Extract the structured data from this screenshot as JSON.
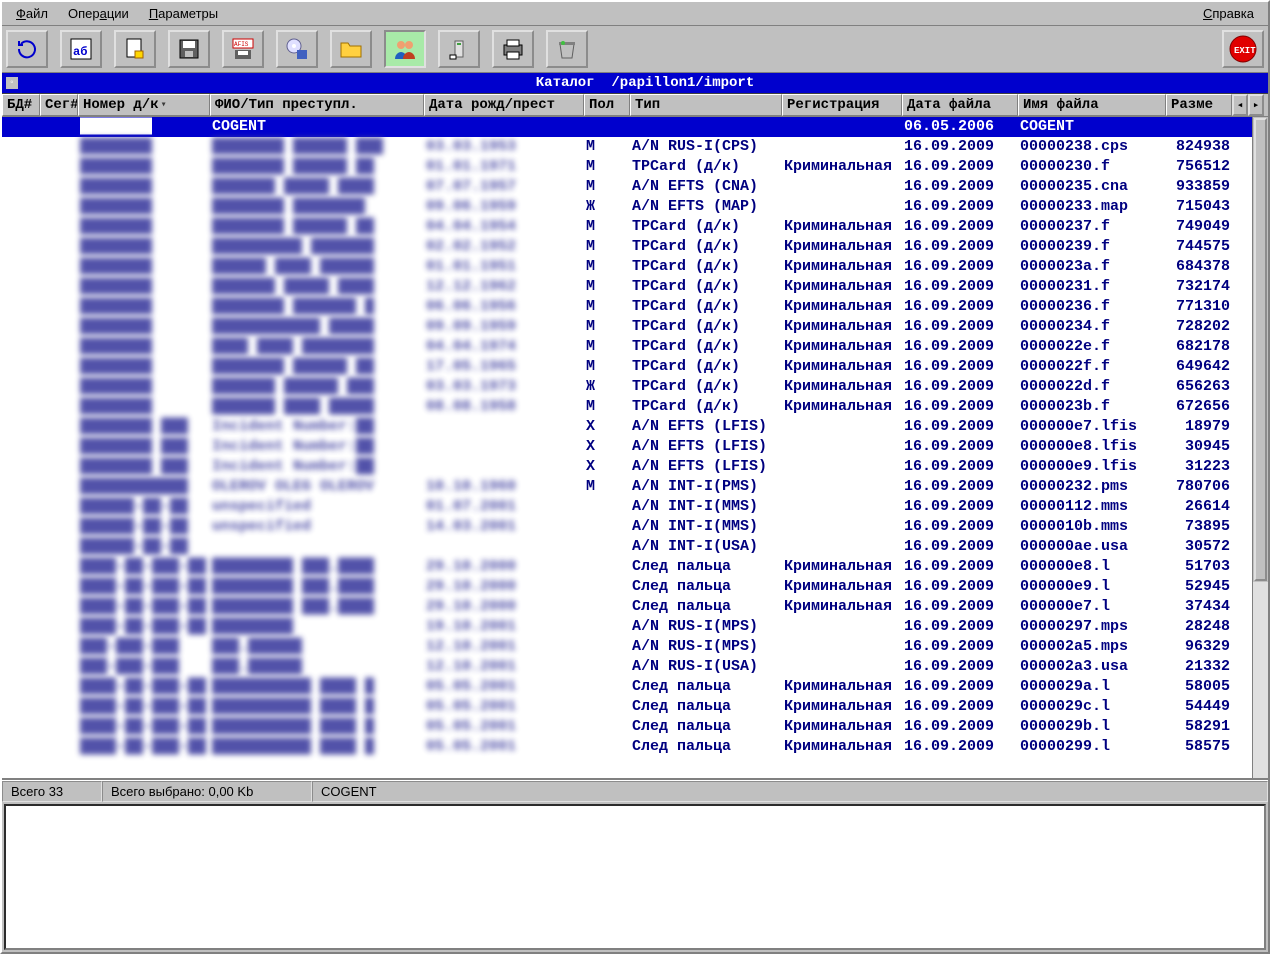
{
  "menu": {
    "file": "Файл",
    "ops": "Операции",
    "params": "Параметры",
    "help": "Справка"
  },
  "toolbar_icons": [
    "refresh",
    "font-ab",
    "doc-lock",
    "save",
    "afis-disk",
    "cd-export",
    "folder",
    "people",
    "tower",
    "printer",
    "trash",
    "exit"
  ],
  "catalog": {
    "label": "Каталог",
    "path": "/papillon1/import"
  },
  "columns": {
    "bd": "БД#",
    "seg": "Сег#",
    "num": "Номер д/к",
    "fio": "ФИО/Тип преступл.",
    "date": "Дата рожд/прест",
    "sex": "Пол",
    "type": "Тип",
    "reg": "Регистрация",
    "fdate": "Дата файла",
    "fname": "Имя файла",
    "size": "Разме"
  },
  "rows": [
    {
      "num": "████████",
      "fio": "COGENT",
      "date": "",
      "sex": "",
      "type": "",
      "reg": "",
      "fdate": "06.05.2006",
      "fname": "COGENT",
      "size": "",
      "selected": true
    },
    {
      "num": "████████",
      "fio": "████████ ██████ ███",
      "date": "03.03.1953",
      "sex": "М",
      "type": "A/N RUS-I(CPS)",
      "reg": "",
      "fdate": "16.09.2009",
      "fname": "00000238.cps",
      "size": "824938"
    },
    {
      "num": "████████",
      "fio": "████████ ██████ ██",
      "date": "01.01.1971",
      "sex": "М",
      "type": "TPCard (д/к)",
      "reg": "Криминальная",
      "fdate": "16.09.2009",
      "fname": "00000230.f",
      "size": "756512"
    },
    {
      "num": "████████",
      "fio": "███████ █████ ████",
      "date": "07.07.1957",
      "sex": "М",
      "type": "A/N EFTS (CNA)",
      "reg": "",
      "fdate": "16.09.2009",
      "fname": "00000235.cna",
      "size": "933859"
    },
    {
      "num": "████████",
      "fio": "████████ ████████",
      "date": "09.06.1959",
      "sex": "Ж",
      "type": "A/N EFTS (MAP)",
      "reg": "",
      "fdate": "16.09.2009",
      "fname": "00000233.map",
      "size": "715043"
    },
    {
      "num": "████████",
      "fio": "████████ ██████ ██",
      "date": "04.04.1954",
      "sex": "М",
      "type": "TPCard (д/к)",
      "reg": "Криминальная",
      "fdate": "16.09.2009",
      "fname": "00000237.f",
      "size": "749049"
    },
    {
      "num": "████████",
      "fio": "██████████ ███████",
      "date": "02.02.1952",
      "sex": "М",
      "type": "TPCard (д/к)",
      "reg": "Криминальная",
      "fdate": "16.09.2009",
      "fname": "00000239.f",
      "size": "744575"
    },
    {
      "num": "████████",
      "fio": "██████ ████ ██████",
      "date": "01.01.1951",
      "sex": "М",
      "type": "TPCard (д/к)",
      "reg": "Криминальная",
      "fdate": "16.09.2009",
      "fname": "0000023a.f",
      "size": "684378"
    },
    {
      "num": "████████",
      "fio": "███████ █████ ████",
      "date": "12.12.1962",
      "sex": "М",
      "type": "TPCard (д/к)",
      "reg": "Криминальная",
      "fdate": "16.09.2009",
      "fname": "00000231.f",
      "size": "732174"
    },
    {
      "num": "████████",
      "fio": "████████ ███████ █",
      "date": "06.06.1956",
      "sex": "М",
      "type": "TPCard (д/к)",
      "reg": "Криминальная",
      "fdate": "16.09.2009",
      "fname": "00000236.f",
      "size": "771310"
    },
    {
      "num": "████████",
      "fio": "████████████ █████",
      "date": "09.09.1959",
      "sex": "М",
      "type": "TPCard (д/к)",
      "reg": "Криминальная",
      "fdate": "16.09.2009",
      "fname": "00000234.f",
      "size": "728202"
    },
    {
      "num": "████████",
      "fio": "████ ████ ████████",
      "date": "04.04.1974",
      "sex": "М",
      "type": "TPCard (д/к)",
      "reg": "Криминальная",
      "fdate": "16.09.2009",
      "fname": "0000022e.f",
      "size": "682178"
    },
    {
      "num": "████████",
      "fio": "████████ ██████ ██",
      "date": "17.05.1965",
      "sex": "М",
      "type": "TPCard (д/к)",
      "reg": "Криминальная",
      "fdate": "16.09.2009",
      "fname": "0000022f.f",
      "size": "649642"
    },
    {
      "num": "████████",
      "fio": "███████ ██████ ███",
      "date": "03.03.1973",
      "sex": "Ж",
      "type": "TPCard (д/к)",
      "reg": "Криминальная",
      "fdate": "16.09.2009",
      "fname": "0000022d.f",
      "size": "656263"
    },
    {
      "num": "████████",
      "fio": "███████ ████ █████",
      "date": "08.08.1958",
      "sex": "М",
      "type": "TPCard (д/к)",
      "reg": "Криминальная",
      "fdate": "16.09.2009",
      "fname": "0000023b.f",
      "size": "672656"
    },
    {
      "num": "████████ ███",
      "fio": "Incident Number:██",
      "date": "",
      "sex": "X",
      "type": "A/N EFTS (LFIS)",
      "reg": "",
      "fdate": "16.09.2009",
      "fname": "000000e7.lfis",
      "size": "18979"
    },
    {
      "num": "████████ ███",
      "fio": "Incident Number:██",
      "date": "",
      "sex": "X",
      "type": "A/N EFTS (LFIS)",
      "reg": "",
      "fdate": "16.09.2009",
      "fname": "000000e8.lfis",
      "size": "30945"
    },
    {
      "num": "████████ ███",
      "fio": "Incident Number:██",
      "date": "",
      "sex": "X",
      "type": "A/N EFTS (LFIS)",
      "reg": "",
      "fdate": "16.09.2009",
      "fname": "000000e9.lfis",
      "size": "31223"
    },
    {
      "num": "████████████",
      "fio": "OLEROV OLEG OLEROV",
      "date": "10.10.1960",
      "sex": "М",
      "type": "A/N INT-I(PMS)",
      "reg": "",
      "fdate": "16.09.2009",
      "fname": "00000232.pms",
      "size": "780706"
    },
    {
      "num": "██████-██-██",
      "fio": "unspecified",
      "date": "01.07.2001",
      "sex": "",
      "type": "A/N INT-I(MMS)",
      "reg": "",
      "fdate": "16.09.2009",
      "fname": "00000112.mms",
      "size": "26614"
    },
    {
      "num": "██████-██-██",
      "fio": "unspecified",
      "date": "14.03.2001",
      "sex": "",
      "type": "A/N INT-I(MMS)",
      "reg": "",
      "fdate": "16.09.2009",
      "fname": "0000010b.mms",
      "size": "73895"
    },
    {
      "num": "██████-██-██",
      "fio": "",
      "date": "",
      "sex": "",
      "type": "A/N INT-I(USA)",
      "reg": "",
      "fdate": "16.09.2009",
      "fname": "000000ae.usa",
      "size": "30572"
    },
    {
      "num": "████-██-███-██",
      "fio": "█████████ ███.████",
      "date": "29.10.2000",
      "sex": "",
      "type": "След пальца",
      "reg": "Криминальная",
      "fdate": "16.09.2009",
      "fname": "000000e8.l",
      "size": "51703"
    },
    {
      "num": "████-██-███-██",
      "fio": "█████████ ███.████",
      "date": "29.10.2000",
      "sex": "",
      "type": "След пальца",
      "reg": "Криминальная",
      "fdate": "16.09.2009",
      "fname": "000000e9.l",
      "size": "52945"
    },
    {
      "num": "████-██-███-██",
      "fio": "█████████ ███.████",
      "date": "29.10.2000",
      "sex": "",
      "type": "След пальца",
      "reg": "Криминальная",
      "fdate": "16.09.2009",
      "fname": "000000e7.l",
      "size": "37434"
    },
    {
      "num": "████-██-███-██",
      "fio": "█████████",
      "date": "19.10.2001",
      "sex": "",
      "type": "A/N RUS-I(MPS)",
      "reg": "",
      "fdate": "16.09.2009",
      "fname": "00000297.mps",
      "size": "28248"
    },
    {
      "num": "███-███-███",
      "fio": "███.██████",
      "date": "12.10.2001",
      "sex": "",
      "type": "A/N RUS-I(MPS)",
      "reg": "",
      "fdate": "16.09.2009",
      "fname": "000002a5.mps",
      "size": "96329"
    },
    {
      "num": "███-███-███",
      "fio": "███.██████",
      "date": "12.10.2001",
      "sex": "",
      "type": "A/N RUS-I(USA)",
      "reg": "",
      "fdate": "16.09.2009",
      "fname": "000002a3.usa",
      "size": "21332"
    },
    {
      "num": "████-██-███-██",
      "fio": "███████████ ████ █",
      "date": "05.05.2001",
      "sex": "",
      "type": "След пальца",
      "reg": "Криминальная",
      "fdate": "16.09.2009",
      "fname": "0000029a.l",
      "size": "58005"
    },
    {
      "num": "████-██-███-██",
      "fio": "███████████ ████ █",
      "date": "05.05.2001",
      "sex": "",
      "type": "След пальца",
      "reg": "Криминальная",
      "fdate": "16.09.2009",
      "fname": "0000029c.l",
      "size": "54449"
    },
    {
      "num": "████-██-███-██",
      "fio": "███████████ ████ █",
      "date": "05.05.2001",
      "sex": "",
      "type": "След пальца",
      "reg": "Криминальная",
      "fdate": "16.09.2009",
      "fname": "0000029b.l",
      "size": "58291"
    },
    {
      "num": "████-██-███-██",
      "fio": "███████████ ████ █",
      "date": "05.05.2001",
      "sex": "",
      "type": "След пальца",
      "reg": "Криминальная",
      "fdate": "16.09.2009",
      "fname": "00000299.l",
      "size": "58575"
    }
  ],
  "status": {
    "total": "Всего 33",
    "selected": "Всего выбрано: 0,00 Kb",
    "current": "COGENT"
  }
}
